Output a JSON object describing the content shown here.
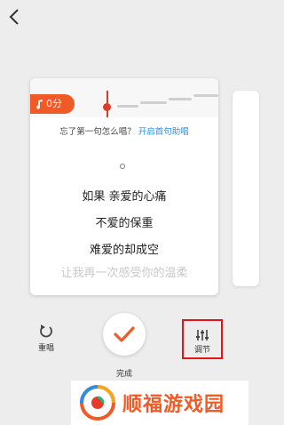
{
  "nav": {
    "back_icon": "back-arrow-icon"
  },
  "card": {
    "score": "0分",
    "hint_prefix": "忘了第一句怎么唱？",
    "hint_link": "开启首句助唱",
    "lyrics": [
      "如果 亲爱的心痛",
      "不爱的保重",
      "难爱的却成空",
      "让我再一次感受你的温柔"
    ]
  },
  "controls": {
    "reset_label": "重唱",
    "done_label": "完成",
    "adjust_label": "调节"
  },
  "watermark": {
    "text": "顺福游戏园"
  },
  "colors": {
    "accent": "#ef5a26",
    "link": "#2b8de6",
    "highlight_box": "#e3151a"
  }
}
